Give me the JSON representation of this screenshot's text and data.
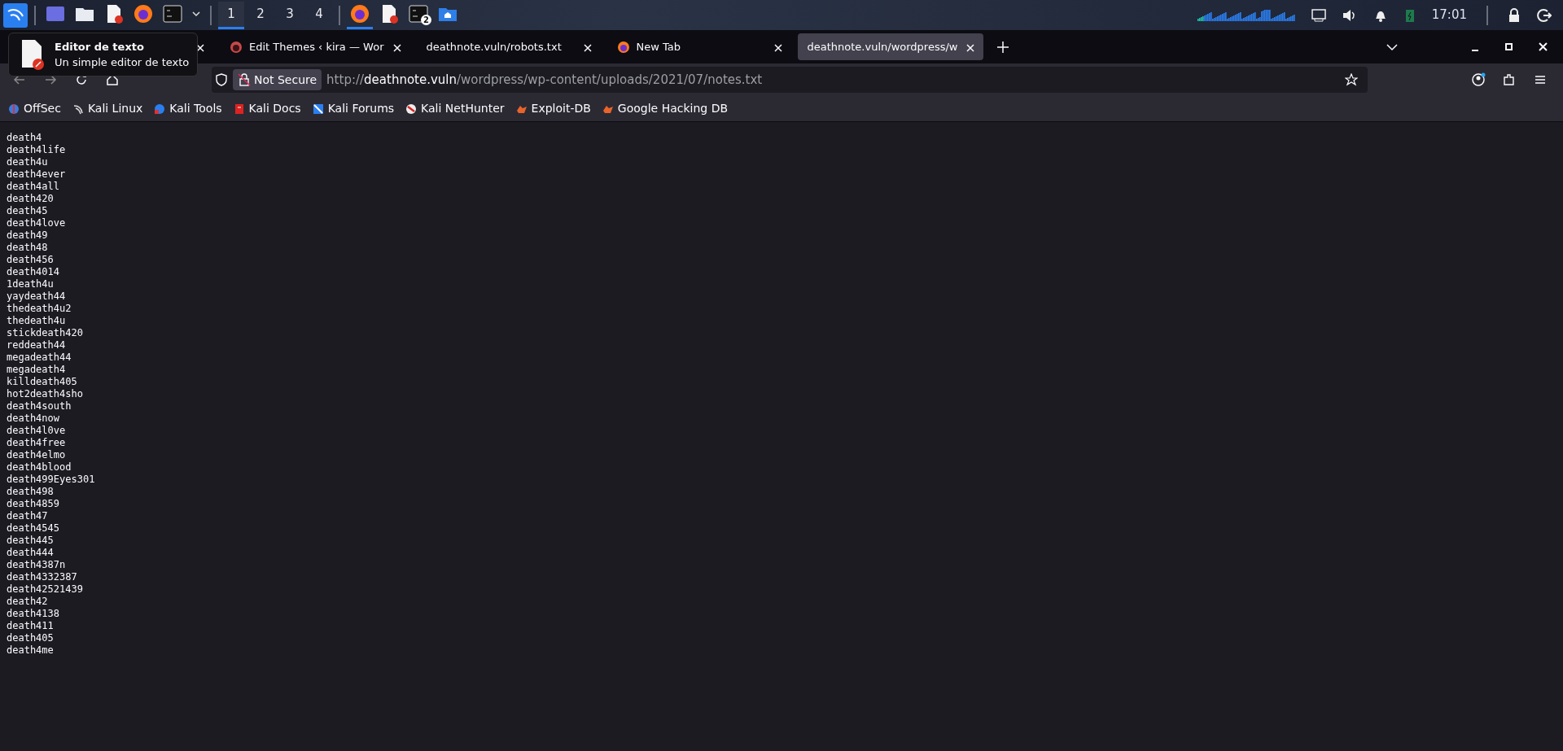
{
  "taskbar": {
    "launchers": [
      {
        "kind": "desktop"
      },
      {
        "kind": "folder"
      },
      {
        "kind": "editor"
      },
      {
        "kind": "firefox"
      },
      {
        "kind": "terminal"
      }
    ],
    "workspaces": [
      {
        "label": "1",
        "selected": true
      },
      {
        "label": "2",
        "selected": false
      },
      {
        "label": "3",
        "selected": false
      },
      {
        "label": "4",
        "selected": false
      }
    ],
    "windows": [
      {
        "kind": "firefox",
        "selected": true
      },
      {
        "kind": "editor",
        "selected": false
      },
      {
        "kind": "terminal",
        "selected": false,
        "badge": "2"
      },
      {
        "kind": "home",
        "selected": false
      }
    ],
    "clock": "17:01"
  },
  "tooltip": {
    "title": "Editor de texto",
    "subtitle": "Un simple editor de texto"
  },
  "tabs": [
    {
      "kind": "hidden",
      "selected": false
    },
    {
      "kind": "wordpress",
      "title": "Edit Themes ‹ kira — Wor",
      "selected": false
    },
    {
      "kind": "plain",
      "title": "deathnote.vuln/robots.txt",
      "selected": false
    },
    {
      "kind": "firefox",
      "title": "New Tab",
      "selected": false
    },
    {
      "kind": "plain",
      "title": "deathnote.vuln/wordpress/w",
      "selected": true
    }
  ],
  "address": {
    "security": "Not Secure",
    "scheme": "http://",
    "host": "deathnote.vuln",
    "path": "/wordpress/wp-content/uploads/2021/07/notes.txt"
  },
  "bookmarks": [
    {
      "kind": "offsec",
      "label": "OffSec"
    },
    {
      "kind": "dragon",
      "label": "Kali Linux"
    },
    {
      "kind": "tools",
      "label": "Kali Tools"
    },
    {
      "kind": "docs",
      "label": "Kali Docs"
    },
    {
      "kind": "forums",
      "label": "Kali Forums"
    },
    {
      "kind": "nethunter",
      "label": "Kali NetHunter"
    },
    {
      "kind": "exploit",
      "label": "Exploit-DB"
    },
    {
      "kind": "exploit",
      "label": "Google Hacking DB"
    }
  ],
  "lines": [
    "death4",
    "death4life",
    "death4u",
    "death4ever",
    "death4all",
    "death420",
    "death45",
    "death4love",
    "death49",
    "death48",
    "death456",
    "death4014",
    "1death4u",
    "yaydeath44",
    "thedeath4u2",
    "thedeath4u",
    "stickdeath420",
    "reddeath44",
    "megadeath44",
    "megadeath4",
    "killdeath405",
    "hot2death4sho",
    "death4south",
    "death4now",
    "death4l0ve",
    "death4free",
    "death4elmo",
    "death4blood",
    "death499Eyes301",
    "death498",
    "death4859",
    "death47",
    "death4545",
    "death445",
    "death444",
    "death4387n",
    "death4332387",
    "death42521439",
    "death42",
    "death4138",
    "death411",
    "death405",
    "death4me"
  ]
}
